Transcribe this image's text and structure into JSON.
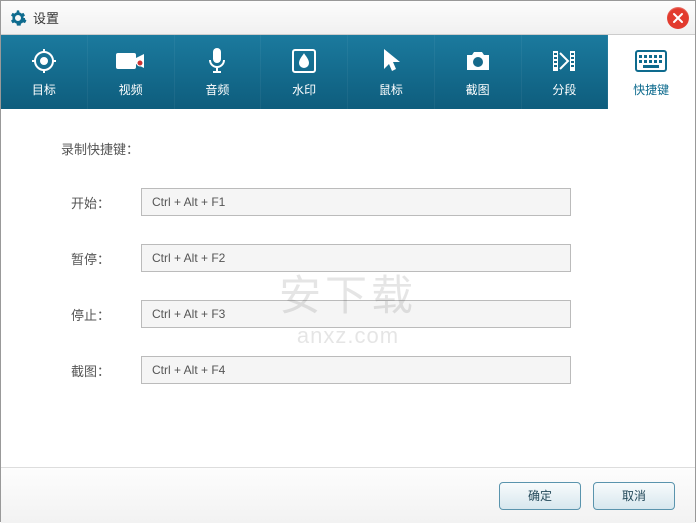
{
  "window": {
    "title": "设置"
  },
  "tabs": [
    {
      "label": "目标",
      "icon": "target-icon"
    },
    {
      "label": "视频",
      "icon": "video-icon"
    },
    {
      "label": "音频",
      "icon": "audio-icon"
    },
    {
      "label": "水印",
      "icon": "watermark-icon"
    },
    {
      "label": "鼠标",
      "icon": "cursor-icon"
    },
    {
      "label": "截图",
      "icon": "camera-icon"
    },
    {
      "label": "分段",
      "icon": "segment-icon"
    },
    {
      "label": "快捷键",
      "icon": "keyboard-icon",
      "active": true
    }
  ],
  "section": {
    "title": "录制快捷键："
  },
  "hotkeys": {
    "start": {
      "label": "开始：",
      "value": "Ctrl + Alt + F1"
    },
    "pause": {
      "label": "暂停：",
      "value": "Ctrl + Alt + F2"
    },
    "stop": {
      "label": "停止：",
      "value": "Ctrl + Alt + F3"
    },
    "shot": {
      "label": "截图：",
      "value": "Ctrl + Alt + F4"
    }
  },
  "buttons": {
    "ok": "确定",
    "cancel": "取消"
  },
  "watermark_text": {
    "line1": "安下载",
    "line2": "anxz.com"
  }
}
